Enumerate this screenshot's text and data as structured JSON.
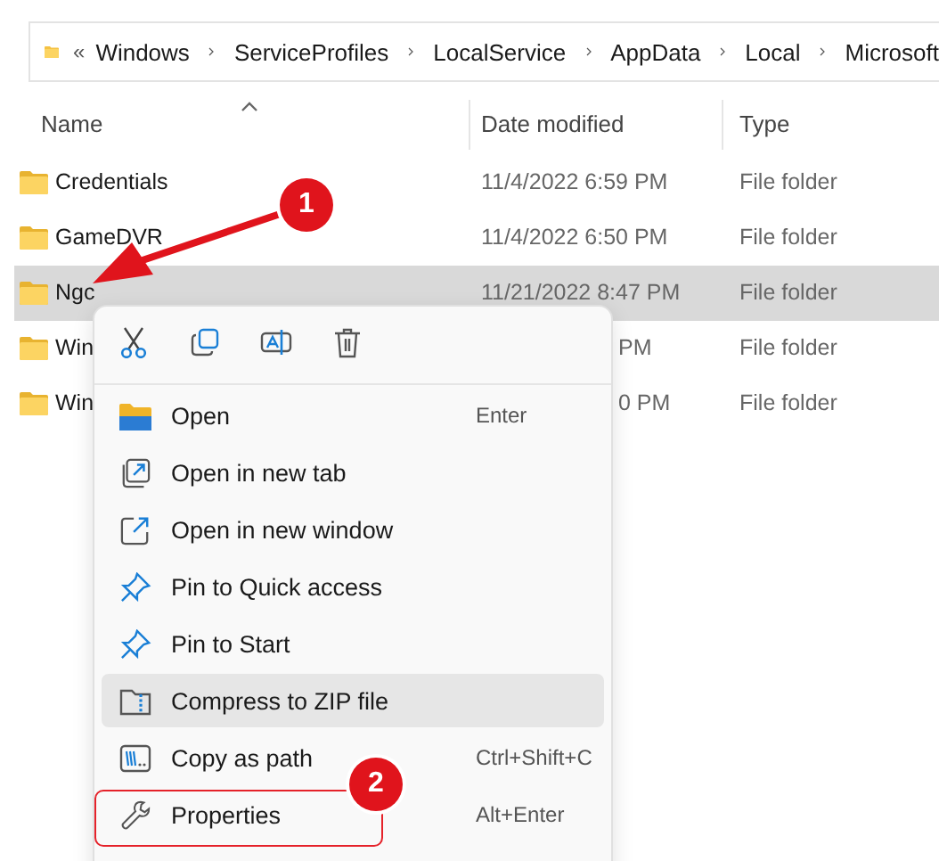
{
  "address_bar": {
    "overflow": "«",
    "segments": [
      "Windows",
      "ServiceProfiles",
      "LocalService",
      "AppData",
      "Local",
      "Microsoft"
    ]
  },
  "columns": [
    "Name",
    "Date modified",
    "Type"
  ],
  "rows": [
    {
      "name": "Credentials",
      "date": "11/4/2022 6:59 PM",
      "type": "File folder",
      "selected": false,
      "covered": false
    },
    {
      "name": "GameDVR",
      "date": "11/4/2022 6:50 PM",
      "type": "File folder",
      "selected": false,
      "covered": false
    },
    {
      "name": "Ngc",
      "date": "11/21/2022 8:47 PM",
      "type": "File folder",
      "selected": true,
      "covered": false
    },
    {
      "name": "Win",
      "date": "PM",
      "type": "File folder",
      "selected": false,
      "covered": true
    },
    {
      "name": "Win",
      "date": "0 PM",
      "type": "File folder",
      "selected": false,
      "covered": true
    }
  ],
  "context_menu": {
    "toolbar": [
      {
        "kind": "cut"
      },
      {
        "kind": "copy"
      },
      {
        "kind": "rename"
      },
      {
        "kind": "delete"
      }
    ],
    "items": [
      {
        "kind": "open",
        "label": "Open",
        "shortcut": "Enter",
        "hovered": false
      },
      {
        "kind": "tab",
        "label": "Open in new tab",
        "hovered": false
      },
      {
        "kind": "window",
        "label": "Open in new window",
        "hovered": false
      },
      {
        "kind": "pin",
        "label": "Pin to Quick access",
        "hovered": false
      },
      {
        "kind": "pin",
        "label": "Pin to Start",
        "hovered": false
      },
      {
        "kind": "zip",
        "label": "Compress to ZIP file",
        "hovered": true
      },
      {
        "kind": "path",
        "label": "Copy as path",
        "shortcut": "Ctrl+Shift+C",
        "hovered": false
      },
      {
        "kind": "wrench",
        "label": "Properties",
        "shortcut": "Alt+Enter",
        "hovered": false
      }
    ]
  },
  "annotations": [
    {
      "label": "1"
    },
    {
      "label": "2"
    }
  ]
}
